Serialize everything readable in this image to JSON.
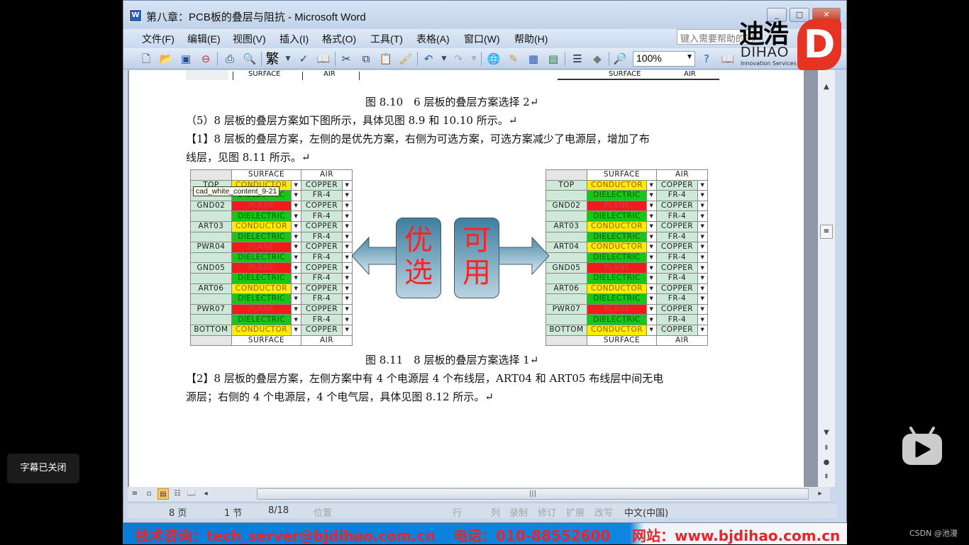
{
  "window": {
    "title": "第八章：PCB板的叠层与阻抗 - Microsoft Word",
    "app_icon": "word-icon",
    "controls": {
      "minimize": "_",
      "maximize": "□",
      "close": "✕"
    }
  },
  "menu": {
    "items": [
      "文件(F)",
      "编辑(E)",
      "视图(V)",
      "插入(I)",
      "格式(O)",
      "工具(T)",
      "表格(A)",
      "窗口(W)",
      "帮助(H)"
    ],
    "help_placeholder": "键入需要帮助的问题"
  },
  "toolbar": {
    "icons": [
      "new-icon",
      "open-icon",
      "save-icon",
      "permission-icon",
      "print-icon",
      "print-preview-icon",
      "traditional-chinese-icon",
      "spelling-icon",
      "research-icon",
      "cut-icon",
      "copy-icon",
      "paste-icon",
      "format-painter-icon",
      "undo-icon",
      "redo-icon",
      "hyperlink-icon",
      "tables-borders-icon",
      "insert-table-icon",
      "insert-excel-icon",
      "columns-icon",
      "drawing-icon",
      "document-map-icon"
    ],
    "trad_glyph": "繁",
    "zoom": "100%"
  },
  "logo": {
    "cn": "迪浩",
    "en": "DIHAO",
    "sub": "Innovation Services",
    "mark": "D"
  },
  "document": {
    "top_table_headers": [
      "SURFACE",
      "AIR"
    ],
    "caption_810": "图 8.10　6 层板的叠层方案选择 2↵",
    "para5": "（5）8 层板的叠层方案如下图所示，具体见图 8.9 和 10.10 所示。↵",
    "para1_line1": "【1】8 层板的叠层方案，左侧的是优先方案，右侧为可选方案，可选方案减少了电源层，增加了布",
    "para1_line2": "线层，见图 8.11 所示。↵",
    "tooltip": "cad_white_content_9-21",
    "left_stack": {
      "headers": [
        "SURFACE",
        "AIR"
      ],
      "footers": [
        "SURFACE",
        "AIR"
      ],
      "rows": [
        {
          "name": "TOP",
          "type": "CONDUCTOR",
          "material": "COPPER"
        },
        {
          "name": "",
          "type": "DIELECTRIC",
          "material": "FR-4"
        },
        {
          "name": "GND02",
          "type": "PLANE",
          "material": "COPPER"
        },
        {
          "name": "",
          "type": "DIELECTRIC",
          "material": "FR-4"
        },
        {
          "name": "ART03",
          "type": "CONDUCTOR",
          "material": "COPPER"
        },
        {
          "name": "",
          "type": "DIELECTRIC",
          "material": "FR-4"
        },
        {
          "name": "PWR04",
          "type": "PLANE",
          "material": "COPPER"
        },
        {
          "name": "",
          "type": "DIELECTRIC",
          "material": "FR-4"
        },
        {
          "name": "GND05",
          "type": "PLANE",
          "material": "COPPER"
        },
        {
          "name": "",
          "type": "DIELECTRIC",
          "material": "FR-4"
        },
        {
          "name": "ART06",
          "type": "CONDUCTOR",
          "material": "COPPER"
        },
        {
          "name": "",
          "type": "DIELECTRIC",
          "material": "FR-4"
        },
        {
          "name": "PWR07",
          "type": "PLANE",
          "material": "COPPER"
        },
        {
          "name": "",
          "type": "DIELECTRIC",
          "material": "FR-4"
        },
        {
          "name": "BOTTOM",
          "type": "CONDUCTOR",
          "material": "COPPER"
        }
      ]
    },
    "right_stack": {
      "headers": [
        "SURFACE",
        "AIR"
      ],
      "footers": [
        "SURFACE",
        "AIR"
      ],
      "rows": [
        {
          "name": "TOP",
          "type": "CONDUCTOR",
          "material": "COPPER"
        },
        {
          "name": "",
          "type": "DIELECTRIC",
          "material": "FR-4"
        },
        {
          "name": "GND02",
          "type": "PLANE",
          "material": "COPPER"
        },
        {
          "name": "",
          "type": "DIELECTRIC",
          "material": "FR-4"
        },
        {
          "name": "ART03",
          "type": "CONDUCTOR",
          "material": "COPPER"
        },
        {
          "name": "",
          "type": "DIELECTRIC",
          "material": "FR-4"
        },
        {
          "name": "ART04",
          "type": "CONDUCTOR",
          "material": "COPPER"
        },
        {
          "name": "",
          "type": "DIELECTRIC",
          "material": "FR-4"
        },
        {
          "name": "GND05",
          "type": "PLANE",
          "material": "COPPER"
        },
        {
          "name": "",
          "type": "DIELECTRIC",
          "material": "FR-4"
        },
        {
          "name": "ART06",
          "type": "CONDUCTOR",
          "material": "COPPER"
        },
        {
          "name": "",
          "type": "DIELECTRIC",
          "material": "FR-4"
        },
        {
          "name": "PWR07",
          "type": "PLANE",
          "material": "COPPER"
        },
        {
          "name": "",
          "type": "DIELECTRIC",
          "material": "FR-4"
        },
        {
          "name": "BOTTOM",
          "type": "CONDUCTOR",
          "material": "COPPER"
        }
      ]
    },
    "arrow_left_label": "优选",
    "arrow_right_label": "可用",
    "type_colors": {
      "CONDUCTOR": "#ffed00",
      "DIELECTRIC": "#17c617",
      "PLANE": "#f21b1b"
    },
    "caption_811": "图 8.11　8 层板的叠层方案选择 1↵",
    "para2_line1": "【2】8 层板的叠层方案，左侧方案中有 4 个电源层 4 个布线层，ART04 和 ART05 布线层中间无电",
    "para2_line2": "源层；右侧的 4 个电源层，4 个电气层，具体见图 8.12 所示。↵"
  },
  "statusbar": {
    "page": "8 页",
    "section": "1 节",
    "page_of": "8/18",
    "position": "位置",
    "line": "行",
    "column": "列",
    "rec": "录制",
    "trk": "修订",
    "ext": "扩展",
    "ovr": "改写",
    "language": "中文(中国)"
  },
  "banner": {
    "tech": "技术咨询：tech_server@bjdihao.com.cn",
    "phone": "电话：010-88552600",
    "site": "网站：www.bjdihao.com.cn"
  },
  "overlay": {
    "subtitle_status": "字幕已关闭",
    "watermark": "CSDN @池漫"
  }
}
